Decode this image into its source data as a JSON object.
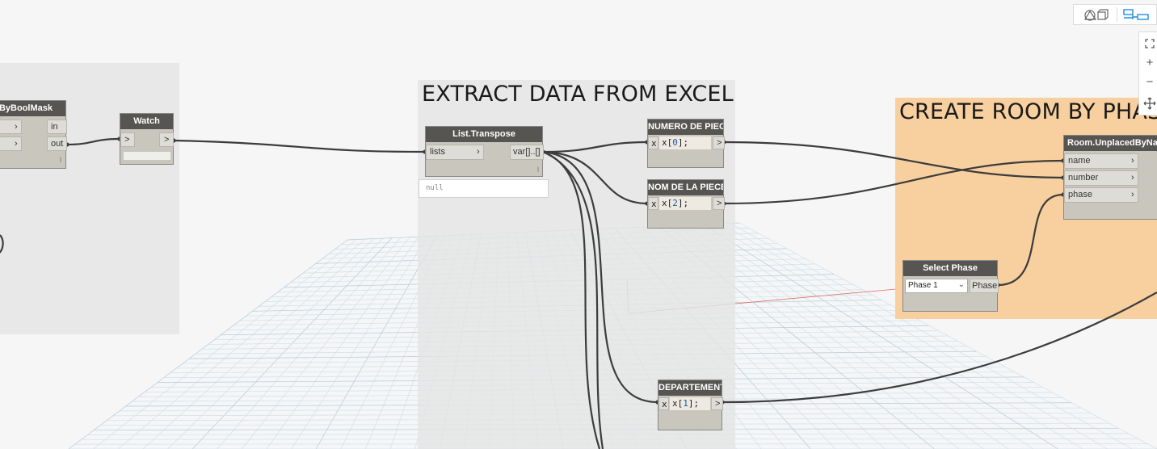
{
  "view_toggle": {
    "geometry_icon": "geometry-view-icon",
    "graph_icon": "graph-view-icon"
  },
  "zoom_controls": {
    "fit_icon": "fit-view-icon",
    "zoom_in_label": "+",
    "zoom_out_label": "−",
    "pan_icon": "pan-icon"
  },
  "groups": {
    "left": {
      "title": ""
    },
    "extract": {
      "title": "EXTRACT DATA FROM EXCEL"
    },
    "create": {
      "title": "CREATE ROOM BY PHASE"
    }
  },
  "nodes": {
    "filter": {
      "title": "FilterByBoolMask",
      "inputs": [
        "",
        ""
      ],
      "outputs": [
        "in",
        "out"
      ],
      "lacing": "l"
    },
    "watch": {
      "title": "Watch",
      "in_arrow": ">",
      "out_arrow": ">"
    },
    "transpose": {
      "title": "List.Transpose",
      "input": "lists",
      "output": "var[]..[]",
      "lacing": "l",
      "preview": "null"
    },
    "numero": {
      "title": "NUMERO DE PIECE",
      "var": "x",
      "code_pre": "x[",
      "code_num": "0",
      "code_post": "];",
      "out_arrow": ">"
    },
    "nom": {
      "title": "NOM DE LA PIECE",
      "var": "x",
      "code_pre": "x[",
      "code_num": "2",
      "code_post": "];",
      "out_arrow": ">"
    },
    "departement": {
      "title": "DEPARTEMENT",
      "var": "x",
      "code_pre": "x[",
      "code_num": "1",
      "code_post": "];",
      "out_arrow": ">"
    },
    "room": {
      "title": "Room.UnplacedByName",
      "inputs": [
        "name",
        "number",
        "phase"
      ]
    },
    "phase": {
      "title": "Select Phase",
      "selected": "Phase 1",
      "output": "Phase"
    }
  },
  "colors": {
    "canvas": "#f6f6f6",
    "group_gray": "#e7e7e7",
    "group_orange": "#f8cf9f",
    "node_body": "#c9c6bd",
    "node_header": "#575552",
    "wire": "#3c3c3c",
    "accent_blue": "#1e8ee0"
  }
}
